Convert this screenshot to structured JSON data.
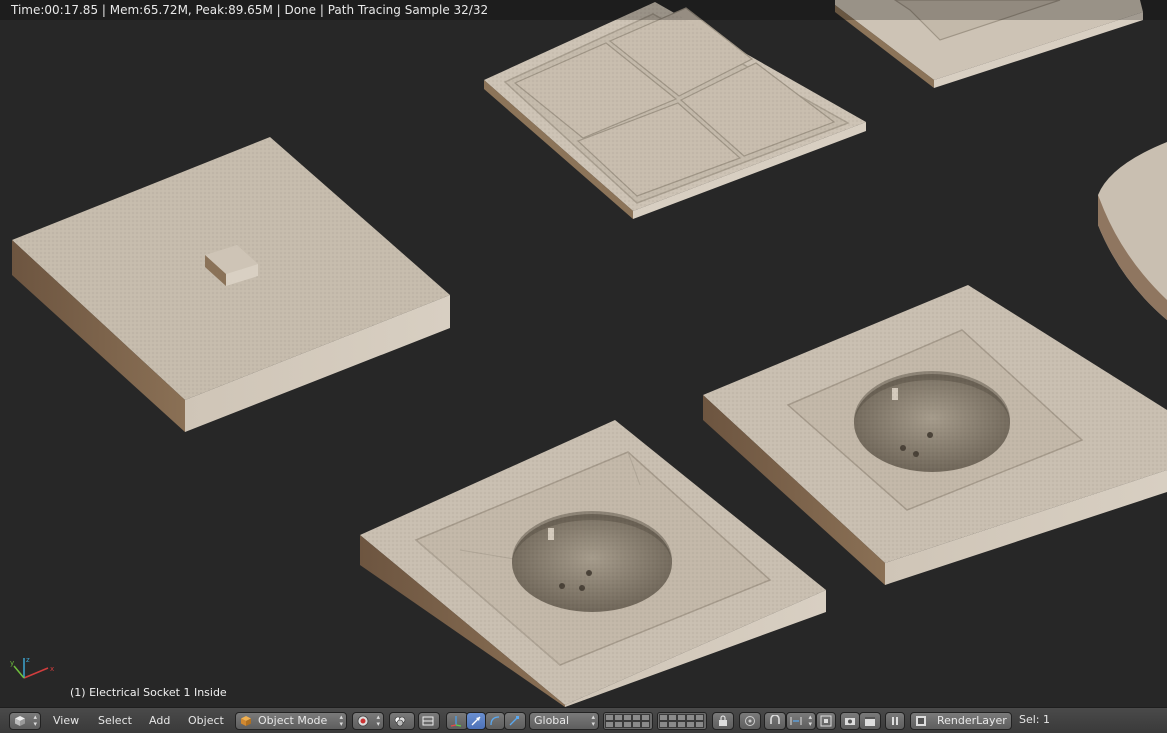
{
  "status": {
    "text": "Time:00:17.85 | Mem:65.72M, Peak:89.65M | Done | Path Tracing Sample 32/32"
  },
  "viewport": {
    "active_object_label": "(1) Electrical Socket 1 Inside"
  },
  "header": {
    "menus": {
      "view": "View",
      "select": "Select",
      "add": "Add",
      "object": "Object"
    },
    "mode_dropdown": "Object Mode",
    "orientation_dropdown": "Global",
    "render_layer": "RenderLayer",
    "selection_count": "Sel: 1"
  },
  "colors": {
    "background": "#272727",
    "header": "#3f3f3f",
    "accent_blue": "#5680c2",
    "material": "#c8bcab"
  },
  "icons": [
    "editor-type-cube-icon",
    "shading-sphere-icon",
    "pivot-icon",
    "manipulator-icon",
    "translate-icon",
    "rotate-icon",
    "scale-icon",
    "layers-grid-icon",
    "lock-icon",
    "proportional-edit-icon",
    "snap-icon",
    "render-still-icon",
    "render-anim-icon",
    "pause-icon",
    "render-layer-icon"
  ]
}
